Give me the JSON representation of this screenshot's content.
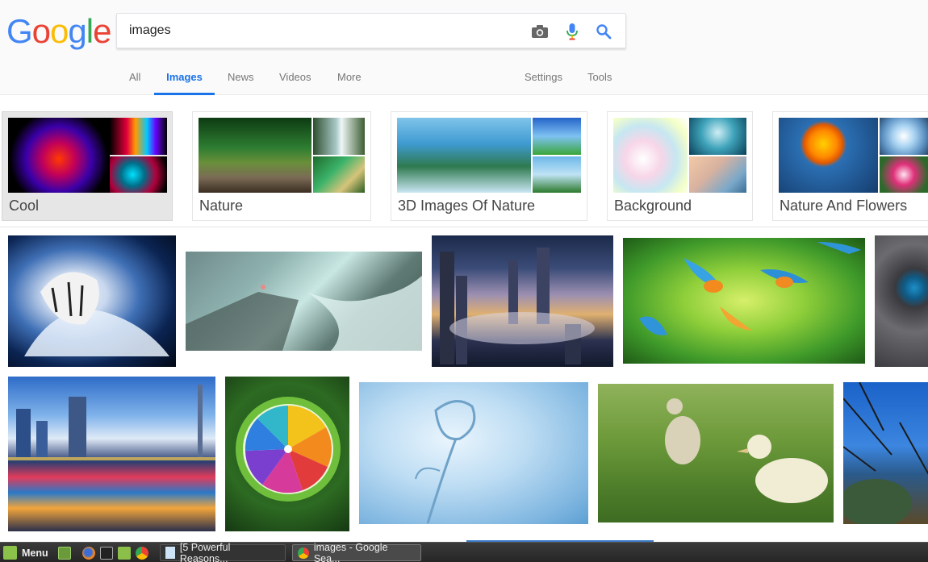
{
  "search": {
    "query": "images"
  },
  "logo": {
    "letters": [
      "G",
      "o",
      "o",
      "g",
      "l",
      "e"
    ],
    "colors": [
      "#4285F4",
      "#EA4335",
      "#FBBC05",
      "#4285F4",
      "#34A853",
      "#EA4335"
    ]
  },
  "tabs": {
    "all": "All",
    "images": "Images",
    "news": "News",
    "videos": "Videos",
    "more": "More",
    "settings": "Settings",
    "tools": "Tools"
  },
  "related": [
    {
      "label": "Cool"
    },
    {
      "label": "Nature"
    },
    {
      "label": "3D Images Of Nature"
    },
    {
      "label": "Background"
    },
    {
      "label": "Nature And Flowers"
    }
  ],
  "taskbar": {
    "menu": "Menu",
    "tasks": [
      {
        "label": "[5 Powerful Reasons..."
      },
      {
        "label": "images - Google Sea..."
      }
    ]
  },
  "colors": {
    "accent": "#1a73e8"
  }
}
